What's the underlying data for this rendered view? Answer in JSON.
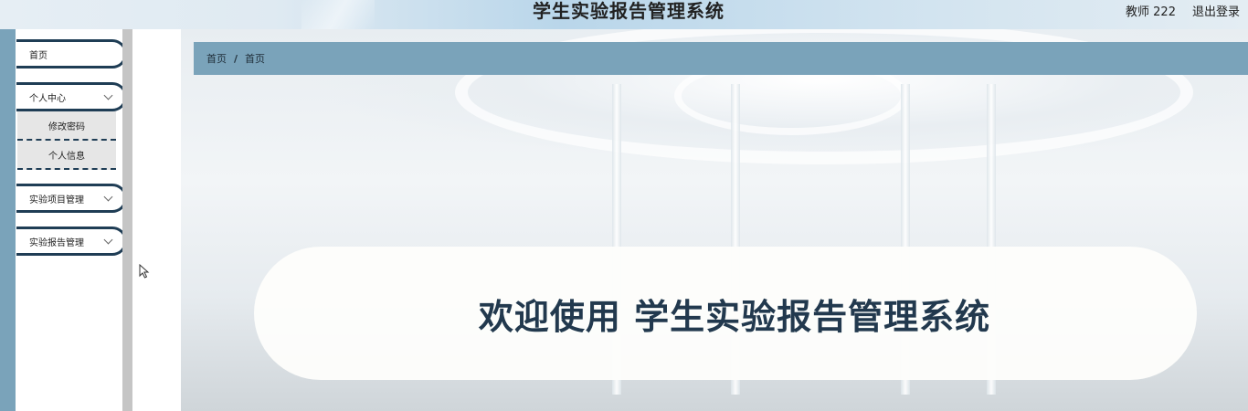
{
  "header": {
    "app_title": "学生实验报告管理系统",
    "user_label": "教师 222",
    "logout_label": "退出登录"
  },
  "sidebar": {
    "items": [
      {
        "label": "首页",
        "expandable": false
      },
      {
        "label": "个人中心",
        "expandable": true,
        "expanded": true,
        "children": [
          {
            "label": "修改密码"
          },
          {
            "label": "个人信息"
          }
        ]
      },
      {
        "label": "实验项目管理",
        "expandable": true,
        "expanded": false
      },
      {
        "label": "实验报告管理",
        "expandable": true,
        "expanded": false
      }
    ]
  },
  "breadcrumb": [
    "首页",
    "首页"
  ],
  "breadcrumb_separator": "/",
  "welcome": {
    "text": "欢迎使用 学生实验报告管理系统"
  },
  "colors": {
    "accent": "#7aa3ba",
    "pill_border": "#1f3d55",
    "welcome_text": "#22394e"
  }
}
